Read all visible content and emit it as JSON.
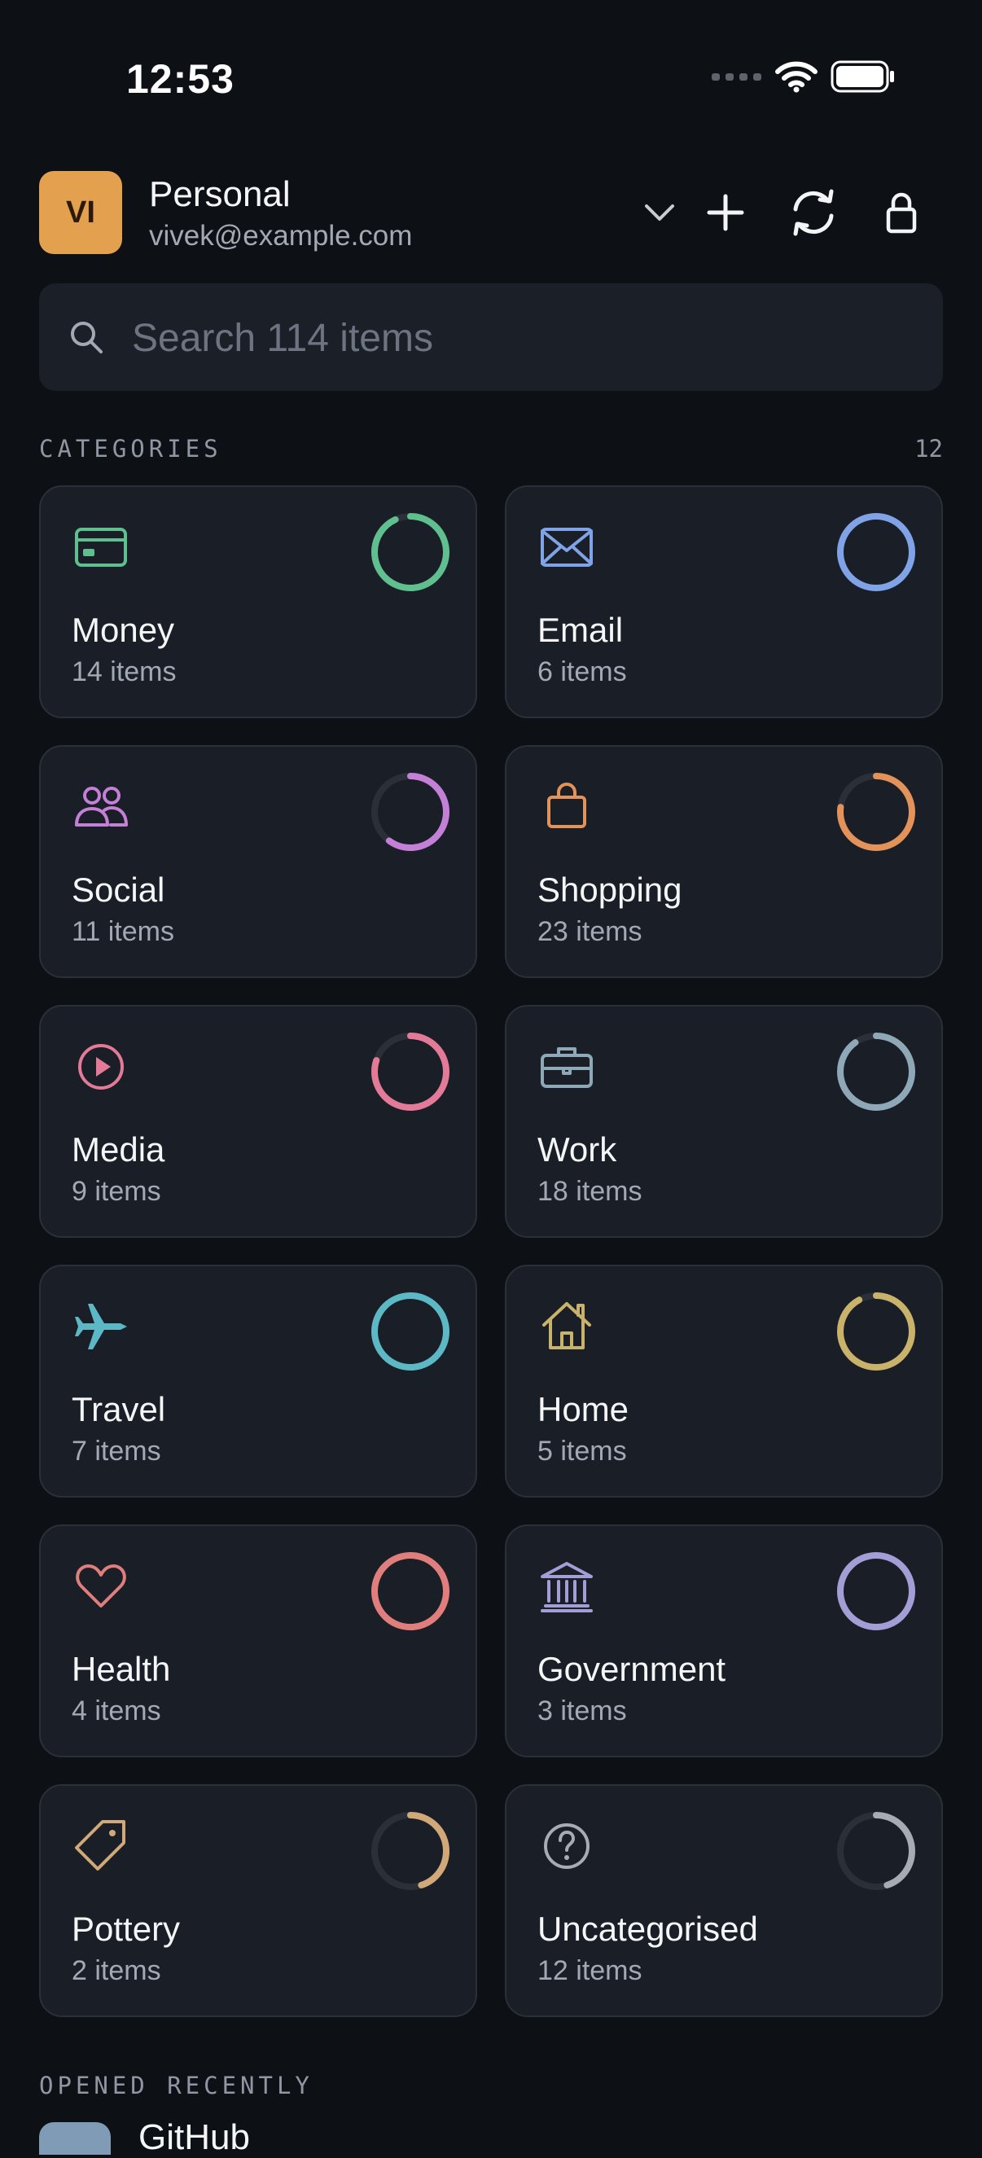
{
  "status": {
    "time": "12:53"
  },
  "account": {
    "initials": "VI",
    "name": "Personal",
    "email": "vivek@example.com"
  },
  "header_actions": [
    "chevron-down-icon",
    "plus-icon",
    "sync-icon",
    "lock-icon"
  ],
  "search": {
    "placeholder": "Search 114 items",
    "value": ""
  },
  "categories": {
    "label": "CATEGORIES",
    "count": "12",
    "items": [
      {
        "name": "Money",
        "count": "14 items",
        "icon": "credit-card-icon",
        "color": "#5fbf8f",
        "fill": 0.93
      },
      {
        "name": "Email",
        "count": "6 items",
        "icon": "envelope-icon",
        "color": "#7fa3e6",
        "fill": 1.0
      },
      {
        "name": "Social",
        "count": "11 items",
        "icon": "people-icon",
        "color": "#c47fd6",
        "fill": 0.6
      },
      {
        "name": "Shopping",
        "count": "23 items",
        "icon": "shopping-bag-icon",
        "color": "#e3935a",
        "fill": 0.77
      },
      {
        "name": "Media",
        "count": "9 items",
        "icon": "play-circle-icon",
        "color": "#e27a98",
        "fill": 0.8
      },
      {
        "name": "Work",
        "count": "18 items",
        "icon": "briefcase-icon",
        "color": "#8fa8b8",
        "fill": 0.9
      },
      {
        "name": "Travel",
        "count": "7 items",
        "icon": "airplane-icon",
        "color": "#5bb8c4",
        "fill": 1.0
      },
      {
        "name": "Home",
        "count": "5 items",
        "icon": "house-icon",
        "color": "#c9b36a",
        "fill": 0.92
      },
      {
        "name": "Health",
        "count": "4 items",
        "icon": "heart-icon",
        "color": "#e07e7e",
        "fill": 1.0
      },
      {
        "name": "Government",
        "count": "3 items",
        "icon": "bank-icon",
        "color": "#a39fd6",
        "fill": 1.0
      },
      {
        "name": "Pottery",
        "count": "2 items",
        "icon": "tag-icon",
        "color": "#d1a878",
        "fill": 0.45
      },
      {
        "name": "Uncategorised",
        "count": "12 items",
        "icon": "question-circle-icon",
        "color": "#a7abb3",
        "fill": 0.45
      }
    ]
  },
  "recent": {
    "label": "OPENED RECENTLY",
    "first_item": "GitHub"
  }
}
